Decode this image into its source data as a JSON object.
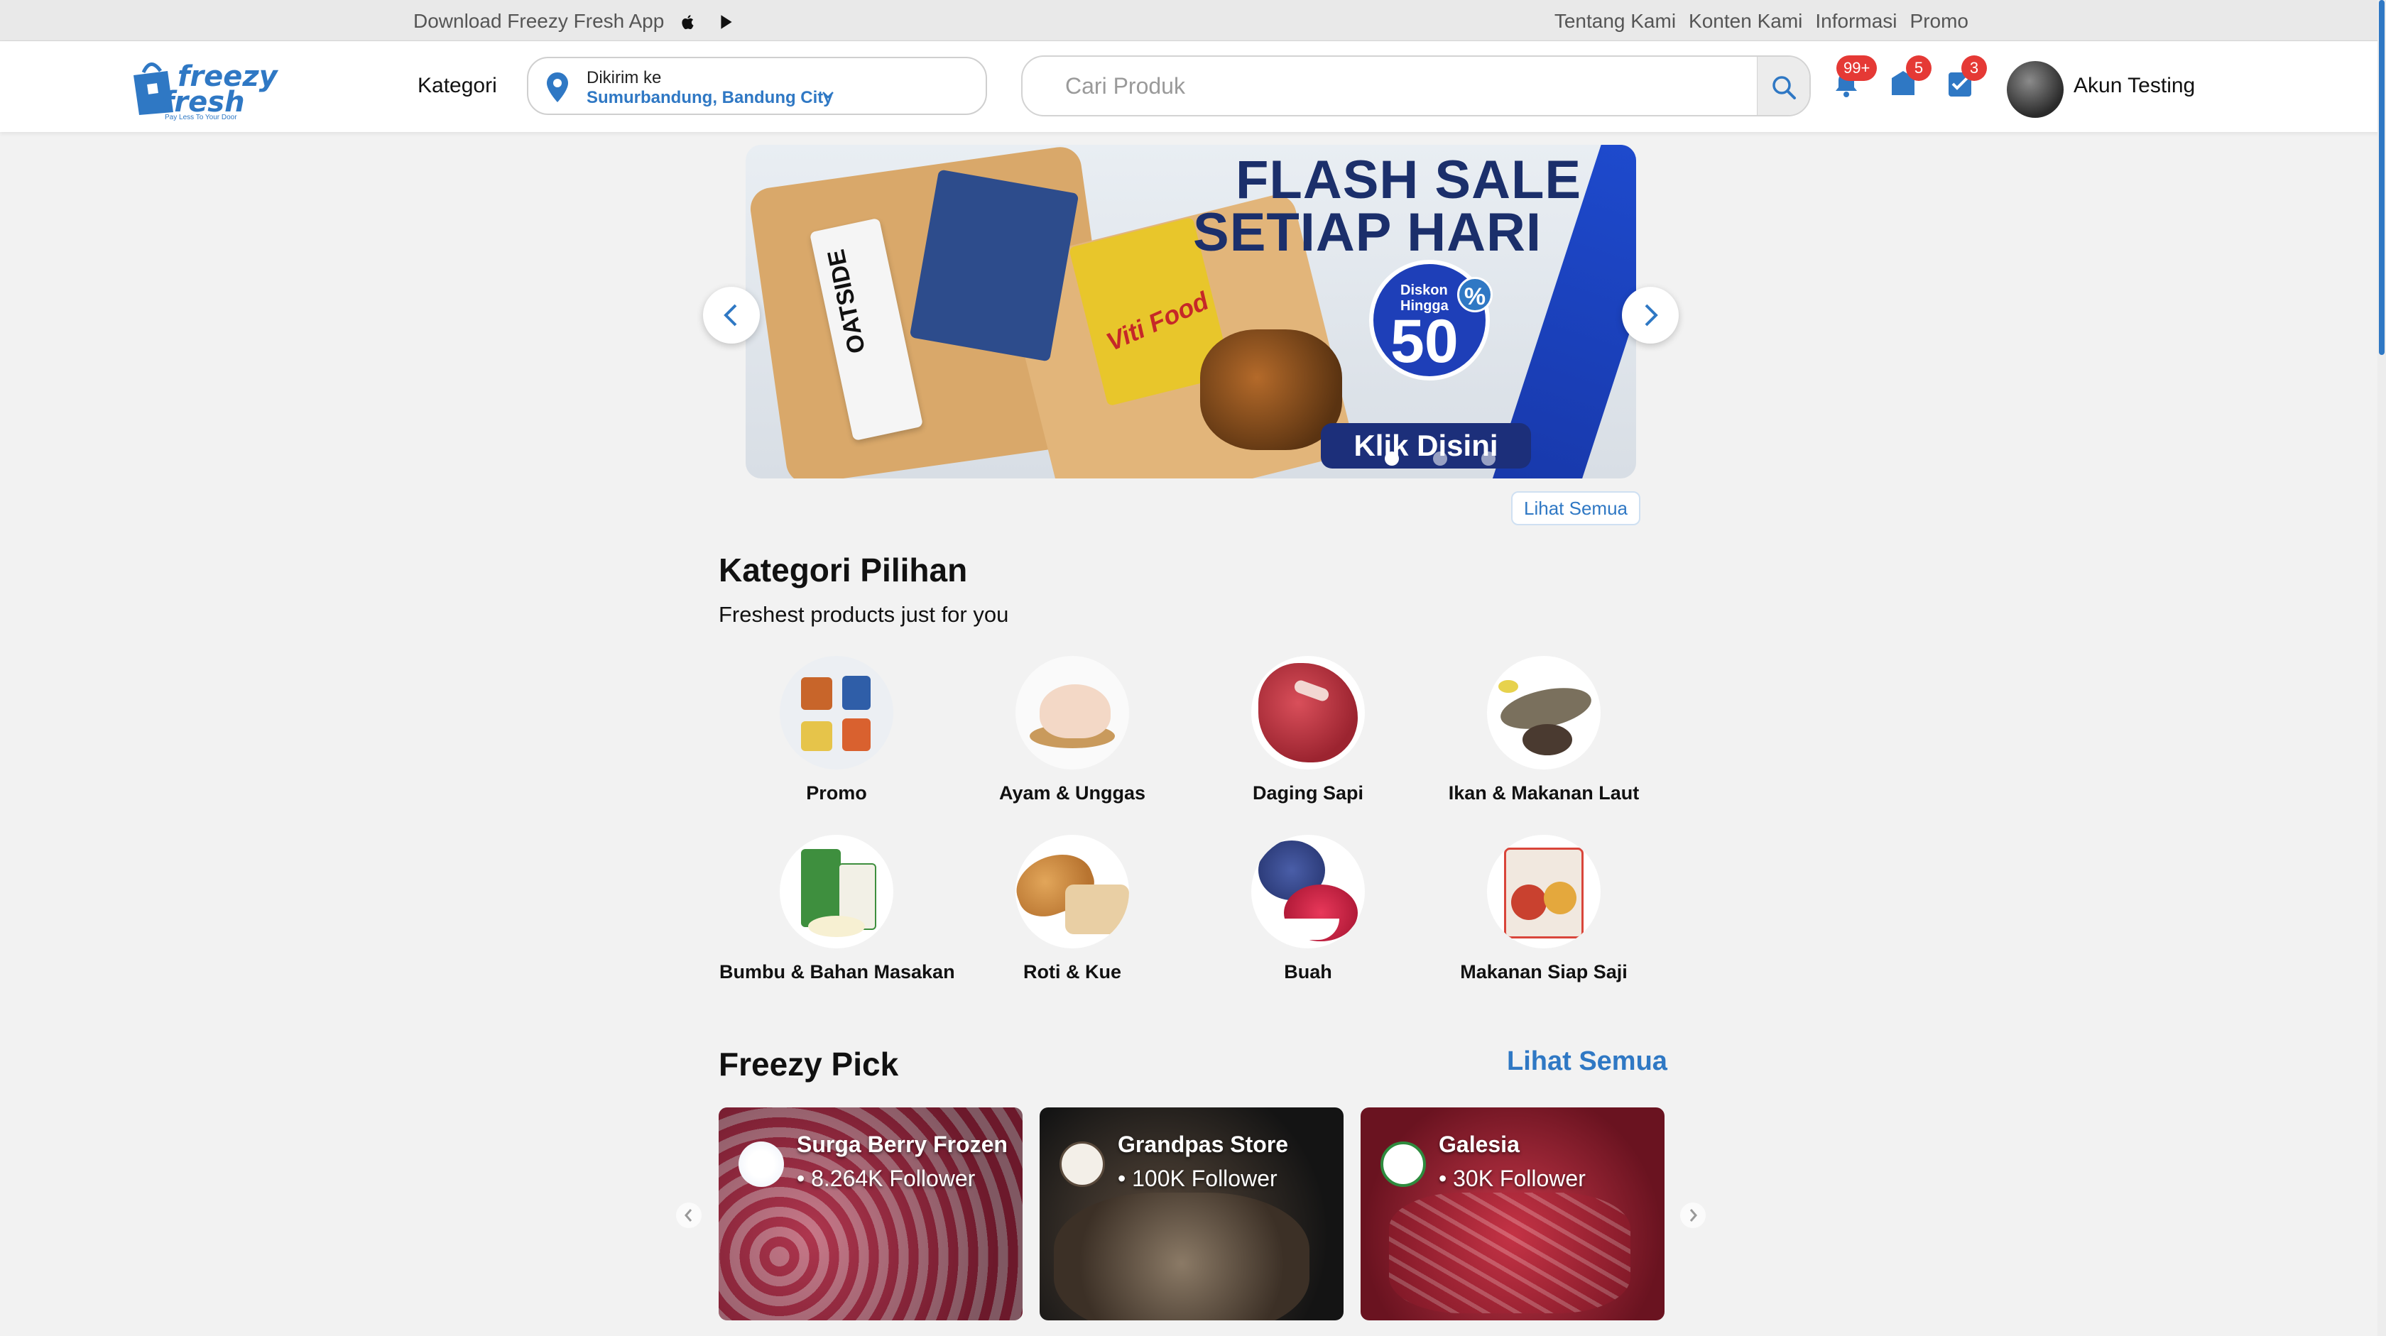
{
  "topbar": {
    "download_text": "Download Freezy Fresh App",
    "links": [
      "Tentang Kami",
      "Konten Kami",
      "Informasi",
      "Promo"
    ]
  },
  "header": {
    "logo_line1": "freezy",
    "logo_line2": "fresh",
    "logo_tagline": "Pay Less To Your Door",
    "kategori": "Kategori",
    "delivery_label": "Dikirim ke",
    "delivery_address": "Sumurbandung, Bandung City",
    "search_placeholder": "Cari Produk",
    "notif_badge": "99+",
    "inbox_badge": "5",
    "orders_badge": "3",
    "account_name": "Akun Testing"
  },
  "banner": {
    "title_line1": "FLASH SALE",
    "title_line2": "SETIAP HARI",
    "discount_label_1": "Diskon",
    "discount_label_2": "Hingga",
    "discount_value": "50",
    "discount_symbol": "%",
    "cta": "Klik Disini",
    "carton_text": "OATSIDE",
    "pack_text": "Viti Food",
    "slides_count": 3,
    "active_slide": 1
  },
  "banner_see_all": "Lihat Semua",
  "kategori_section": {
    "title": "Kategori Pilihan",
    "subtitle": "Freshest products just for you",
    "items": [
      {
        "label": "Promo",
        "icon": "promo-products-image"
      },
      {
        "label": "Ayam & Unggas",
        "icon": "chicken-image"
      },
      {
        "label": "Daging Sapi",
        "icon": "beef-image"
      },
      {
        "label": "Ikan & Makanan Laut",
        "icon": "fish-image"
      },
      {
        "label": "Bumbu & Bahan Masakan",
        "icon": "spices-image"
      },
      {
        "label": "Roti & Kue",
        "icon": "bread-image"
      },
      {
        "label": "Buah",
        "icon": "fruit-image"
      },
      {
        "label": "Makanan Siap Saji",
        "icon": "ready-meal-image"
      }
    ]
  },
  "freezy_pick": {
    "title": "Freezy Pick",
    "see_all": "Lihat Semua",
    "stores": [
      {
        "name": "Surga Berry Frozen",
        "followers": "• 8.264K Follower"
      },
      {
        "name": "Grandpas Store",
        "followers": "• 100K Follower"
      },
      {
        "name": "Galesia",
        "followers": "• 30K Follower"
      }
    ]
  },
  "colors": {
    "brand_blue": "#2f78c4",
    "badge_red": "#e53935",
    "page_bg": "#f2f2f2"
  }
}
